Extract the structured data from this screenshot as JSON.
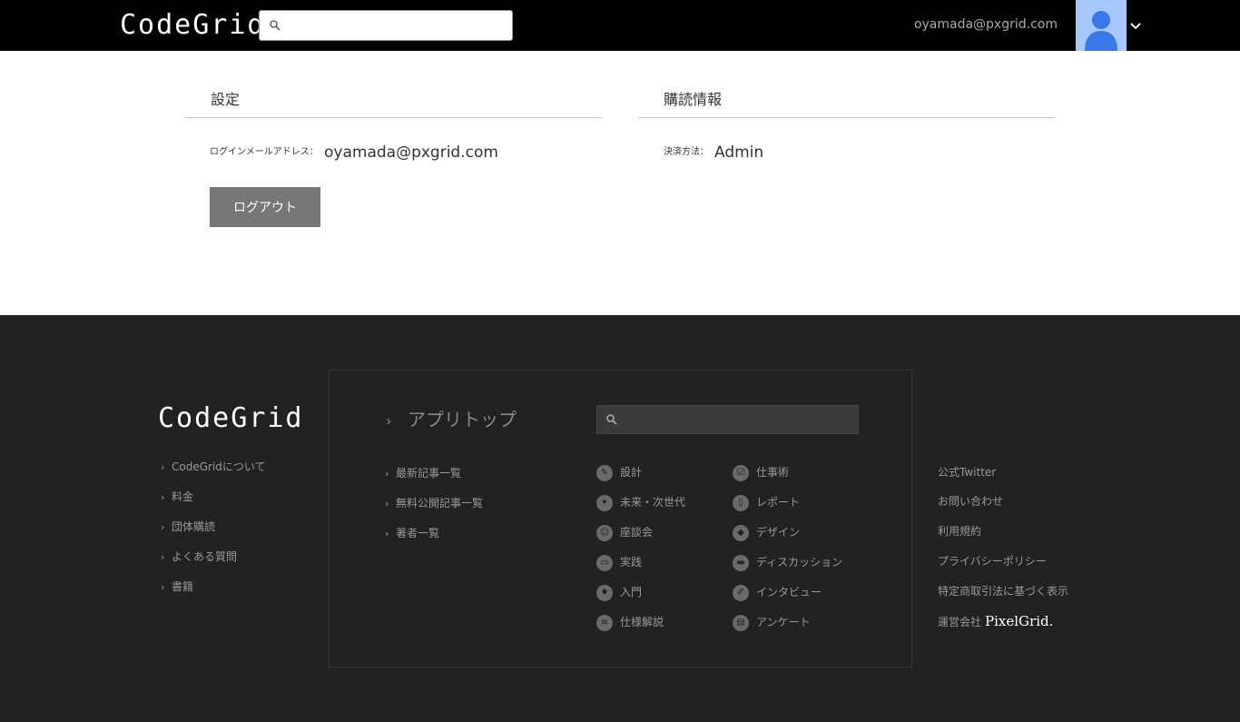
{
  "header": {
    "logo": "CodeGrid",
    "search": {
      "value": "",
      "placeholder": ""
    },
    "user_email": "oyamada@pxgrid.com"
  },
  "settings": {
    "title": "設定",
    "email_label": "ログインメールアドレス：",
    "email_value": "oyamada@pxgrid.com",
    "logout_label": "ログアウト"
  },
  "subscription": {
    "title": "購読情報",
    "payment_label": "決済方法：",
    "payment_value": "Admin"
  },
  "footer": {
    "logo": "CodeGrid",
    "left_links": [
      "CodeGridについて",
      "料金",
      "団体購読",
      "よくある質問",
      "書籍"
    ],
    "app_top": "アプリトップ",
    "search": {
      "value": "",
      "placeholder": ""
    },
    "article_links": [
      "最新記事一覧",
      "無料公開記事一覧",
      "著者一覧"
    ],
    "categories_col1": [
      {
        "label": "設計",
        "icon": "wrench-icon"
      },
      {
        "label": "未来・次世代",
        "icon": "sparkle-icon"
      },
      {
        "label": "座談会",
        "icon": "group-icon"
      },
      {
        "label": "実践",
        "icon": "laptop-icon"
      },
      {
        "label": "入門",
        "icon": "beginner-icon"
      },
      {
        "label": "仕様解説",
        "icon": "spec-icon"
      }
    ],
    "categories_col2": [
      {
        "label": "仕事術",
        "icon": "checklist-icon"
      },
      {
        "label": "レポート",
        "icon": "document-icon"
      },
      {
        "label": "デザイン",
        "icon": "eraser-icon"
      },
      {
        "label": "ディスカッション",
        "icon": "chat-icon"
      },
      {
        "label": "インタビュー",
        "icon": "pen-icon"
      },
      {
        "label": "アンケート",
        "icon": "clipboard-icon"
      }
    ],
    "right_links": [
      "公式Twitter",
      "お問い合わせ",
      "利用規約",
      "プライバシーポリシー",
      "特定商取引法に基づく表示"
    ],
    "company_label": "運営会社",
    "company_logo": "PixelGrid."
  },
  "colors": {
    "header_bg": "#000000",
    "footer_bg": "#222222",
    "avatar_bg": "#a6c8ff",
    "avatar_fg": "#3a78e8",
    "button_bg": "#777777"
  }
}
